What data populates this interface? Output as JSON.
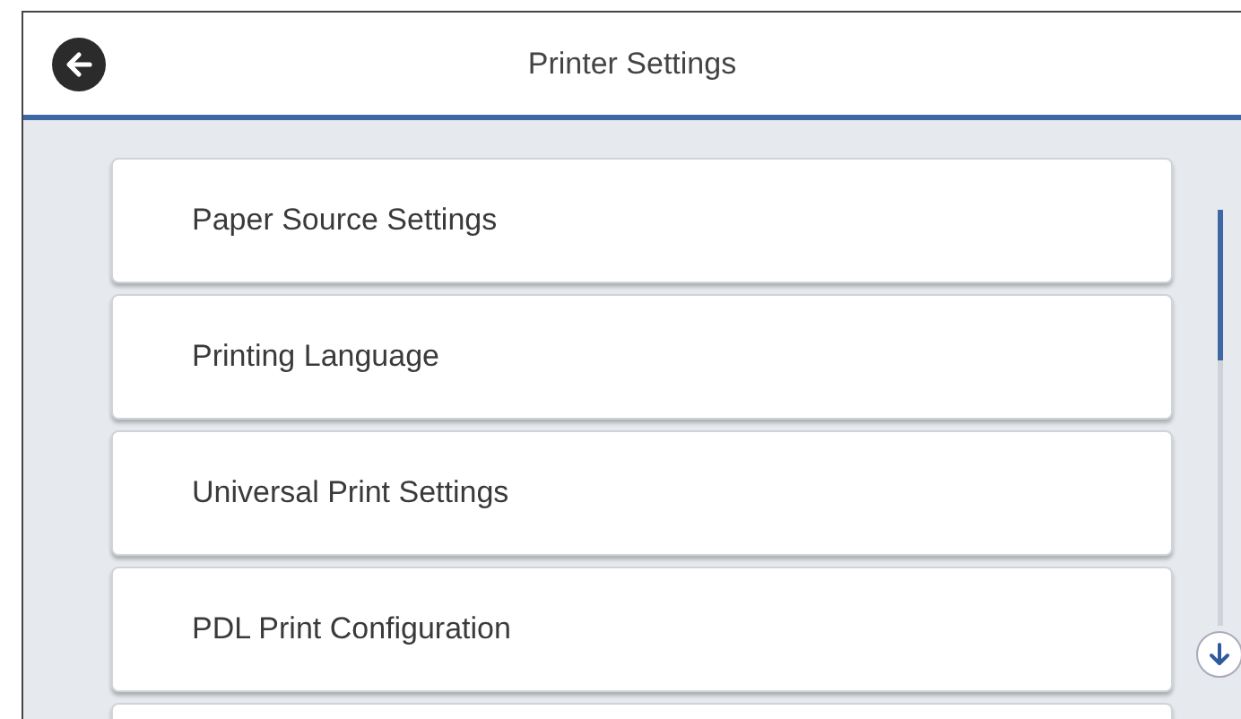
{
  "header": {
    "title": "Printer Settings"
  },
  "menu_items": [
    {
      "label": "Paper Source Settings"
    },
    {
      "label": "Printing Language"
    },
    {
      "label": "Universal Print Settings"
    },
    {
      "label": "PDL Print Configuration"
    }
  ]
}
